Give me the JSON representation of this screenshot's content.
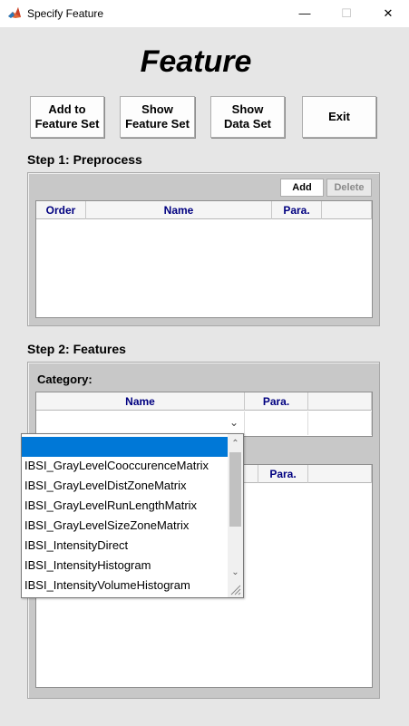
{
  "window": {
    "title": "Specify Feature",
    "minimize_glyph": "—",
    "maximize_glyph": "☐",
    "close_glyph": "✕"
  },
  "heading": "Feature",
  "buttons": {
    "add_to_feature_set": "Add to\nFeature Set",
    "show_feature_set": "Show\nFeature Set",
    "show_data_set": "Show\nData Set",
    "exit": "Exit"
  },
  "step1": {
    "title": "Step 1: Preprocess",
    "add_label": "Add",
    "delete_label": "Delete",
    "columns": [
      "Order",
      "Name",
      "Para.",
      ""
    ]
  },
  "step2": {
    "title": "Step 2: Features",
    "category_label": "Category:",
    "category_columns": [
      "Name",
      "Para.",
      ""
    ],
    "feature_columns": [
      "Para.",
      ""
    ],
    "dropdown_chevron": "⌄",
    "dropdown_options": [
      "",
      "IBSI_GrayLevelCooccurenceMatrix",
      "IBSI_GrayLevelDistZoneMatrix",
      "IBSI_GrayLevelRunLengthMatrix",
      "IBSI_GrayLevelSizeZoneMatrix",
      "IBSI_IntensityDirect",
      "IBSI_IntensityHistogram",
      "IBSI_IntensityVolumeHistogram"
    ],
    "scroll_up": "⌃",
    "scroll_down": "⌄"
  }
}
